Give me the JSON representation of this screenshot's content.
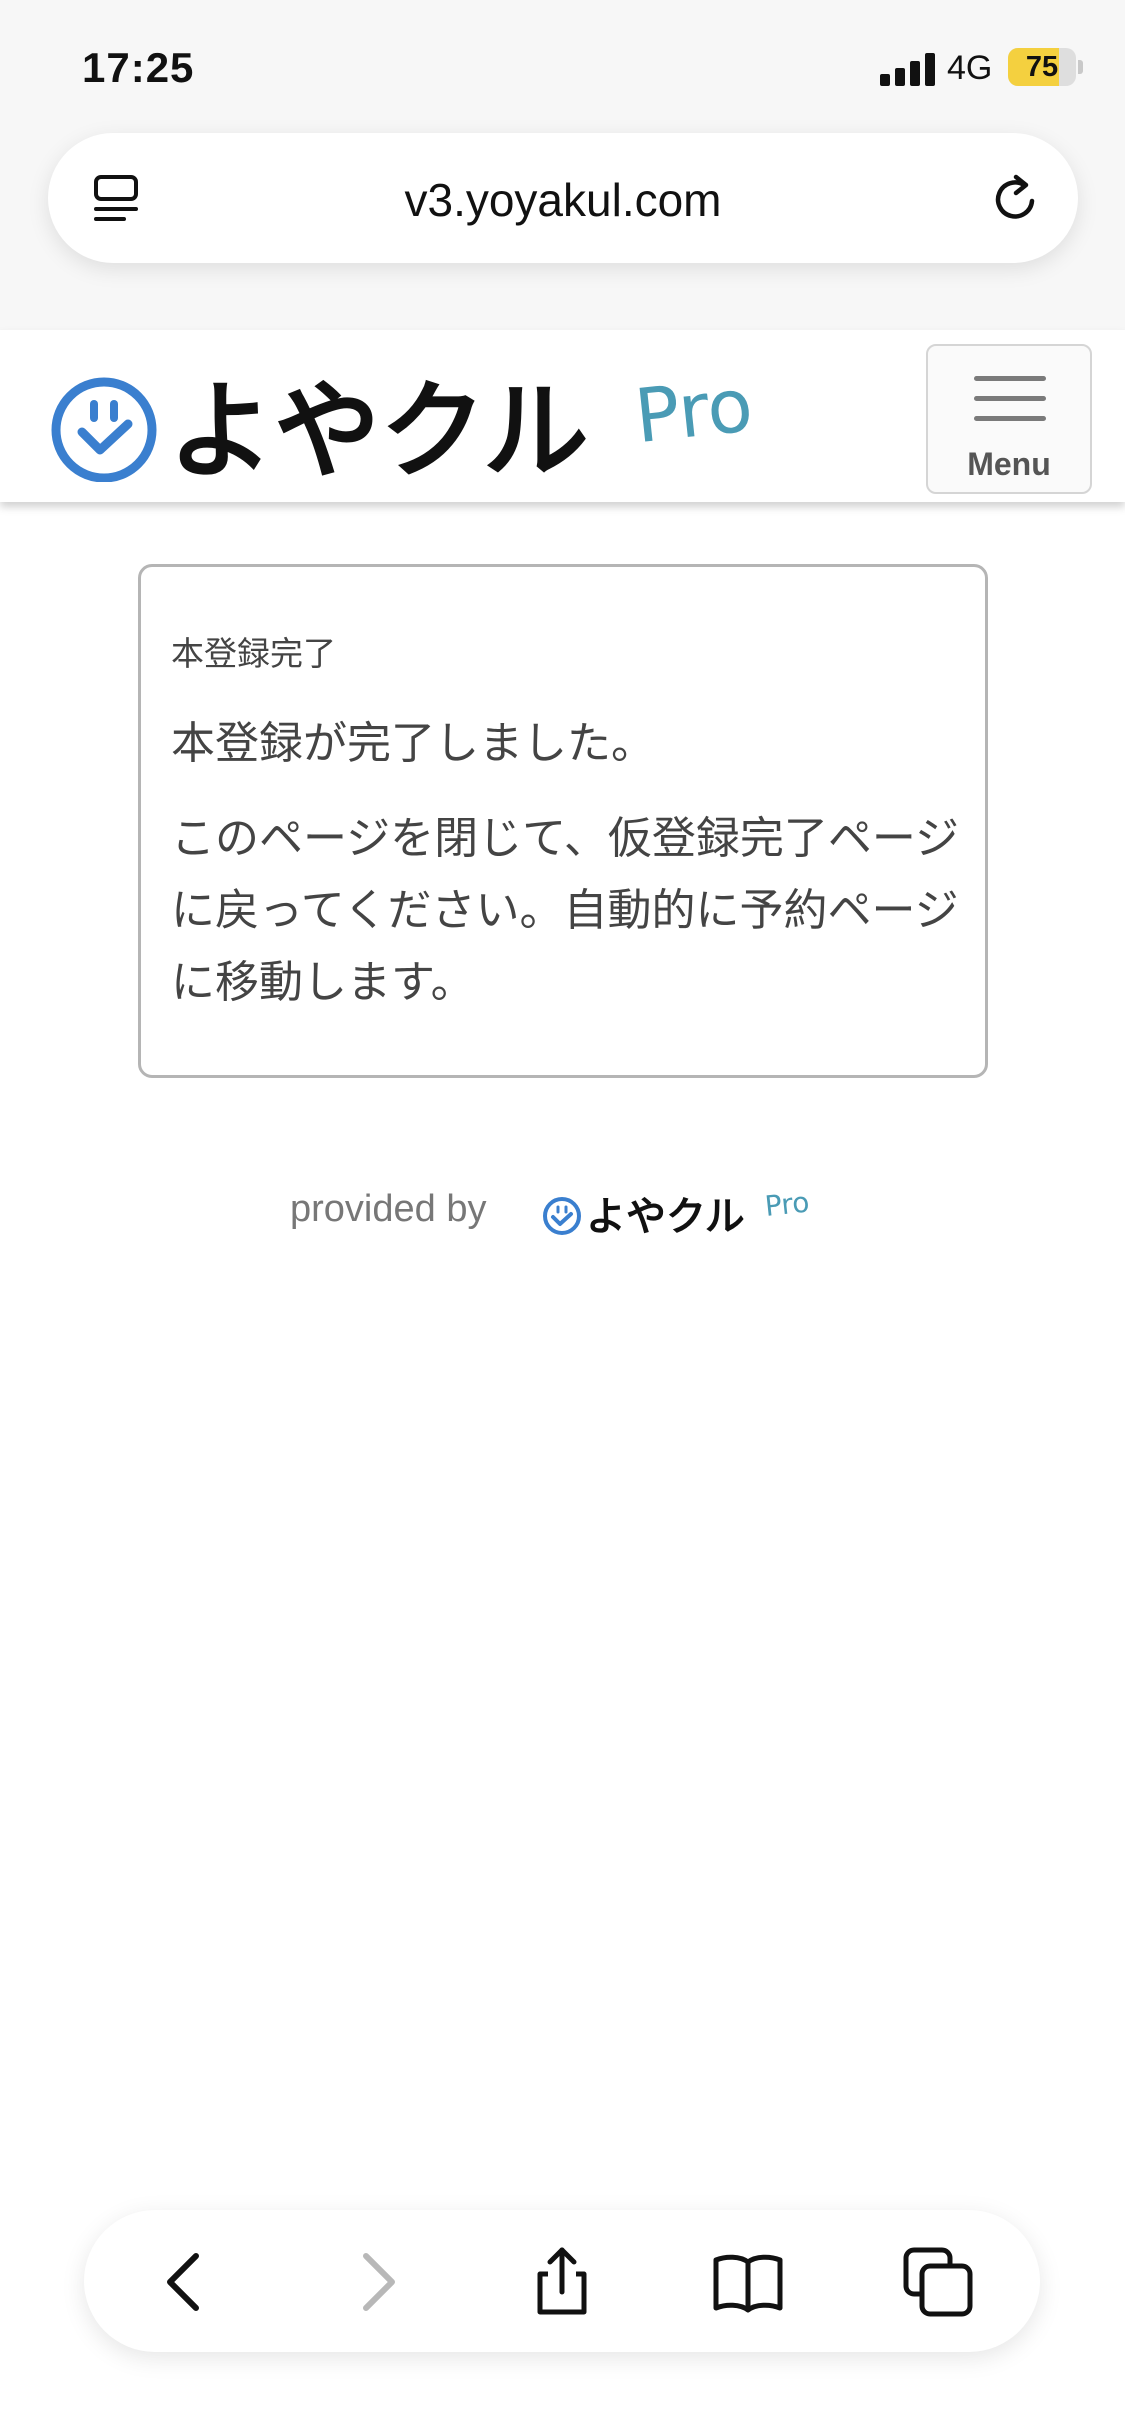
{
  "status_bar": {
    "time": "17:25",
    "network": "4G",
    "battery_percent": "75",
    "battery_level": 0.75
  },
  "browser": {
    "url": "v3.yoyakul.com",
    "icons": [
      "tab-list-icon",
      "reload-icon"
    ],
    "toolbar_icons": [
      "back-icon",
      "forward-icon",
      "share-icon",
      "bookmarks-icon",
      "tabs-icon"
    ]
  },
  "header": {
    "logo_text": "よやクル",
    "logo_suffix": "Pro",
    "menu_label": "Menu"
  },
  "card": {
    "title": "本登録完了",
    "lead": "本登録が完了しました。",
    "body": "このページを閉じて、仮登録完了ページに戻ってください。自動的に予約ページに移動します。"
  },
  "footer": {
    "provided_by": "provided by",
    "logo_text": "よやクル",
    "logo_suffix": "Pro"
  },
  "colors": {
    "brand_blue": "#3a7fcf",
    "pro_teal": "#4a9bb5",
    "battery_yellow": "#f4d03f"
  }
}
